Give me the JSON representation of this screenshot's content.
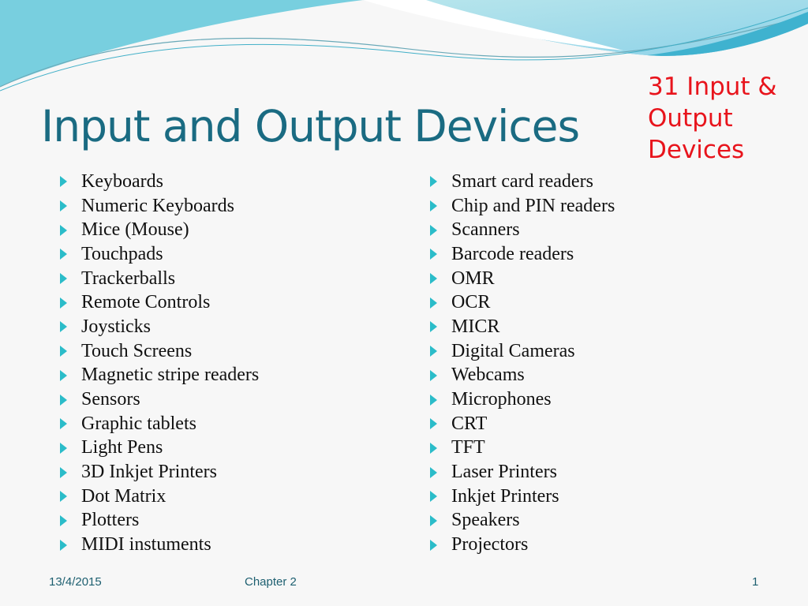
{
  "slide": {
    "title": "Input and Output Devices",
    "callout": "31 Input & Output Devices",
    "left_column": [
      "Keyboards",
      "Numeric Keyboards",
      "Mice (Mouse)",
      "Touchpads",
      "Trackerballs",
      "Remote Controls",
      "Joysticks",
      "Touch Screens",
      "Magnetic stripe readers",
      "Sensors",
      "Graphic tablets",
      "Light Pens",
      "3D Inkjet Printers",
      "Dot Matrix",
      "Plotters",
      "MIDI instuments"
    ],
    "right_column": [
      "Smart card readers",
      "Chip and PIN readers",
      "Scanners",
      "Barcode readers",
      "OMR",
      "OCR",
      "MICR",
      "Digital Cameras",
      "Webcams",
      "Microphones",
      "CRT",
      "TFT",
      "Laser Printers",
      "Inkjet Printers",
      "Speakers",
      "Projectors"
    ],
    "bullet_icon": "triangle-right-icon",
    "colors": {
      "title": "#1a6b82",
      "callout": "#e8141c",
      "bullet": "#2bbcc9",
      "footer": "#1d5f70"
    }
  },
  "footer": {
    "date": "13/4/2015",
    "chapter": "Chapter 2",
    "page_number": "1"
  }
}
